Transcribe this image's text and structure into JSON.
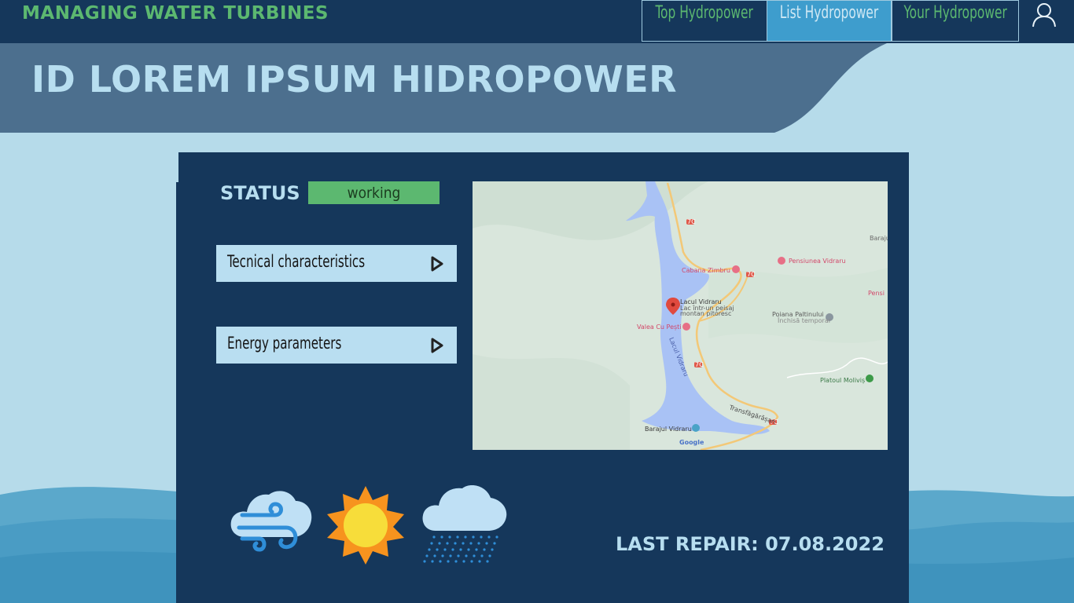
{
  "brand": "MANAGING WATER TURBINES",
  "nav": {
    "tabs": [
      {
        "label": "Top Hydropower",
        "active": false
      },
      {
        "label": "List Hydropower",
        "active": true
      },
      {
        "label": "Your Hydropower",
        "active": false
      }
    ],
    "user_icon": "user-icon"
  },
  "page": {
    "title": "ID LOREM IPSUM HIDROPOWER"
  },
  "status": {
    "label": "STATUS",
    "value": "working",
    "color": "#5cb870"
  },
  "sections": [
    {
      "label": "Tecnical characteristics",
      "icon": "play-arrow-icon"
    },
    {
      "label": "Energy parameters",
      "icon": "play-arrow-icon"
    }
  ],
  "map": {
    "labels": {
      "lake": "Lacul Vidraru",
      "lake_desc_1": "Lac într-un peisaj",
      "lake_desc_2": "montan pitoresc",
      "lake_vertical": "Lacul Vidraru",
      "cabana": "Cabana Zimbru",
      "pensiunea": "Pensiunea Vidraru",
      "poiana": "Poiana Paltinului",
      "poiana_status": "Închisă temporar",
      "valea": "Valea Cu Pești",
      "platoul": "Platoul Moliviș",
      "baraj_top": "Baraju",
      "pensi_right": "Pensi",
      "transfagarasan": "Transfăgărășan",
      "barajul": "Barajul Vidraru",
      "road": "7C",
      "google": "Google"
    }
  },
  "weather": [
    {
      "icon": "cloud-wind-icon"
    },
    {
      "icon": "sun-icon"
    },
    {
      "icon": "cloud-rain-icon"
    }
  ],
  "last_repair": "LAST REPAIR: 07.08.2022",
  "colors": {
    "page_bg": "#b6dbea",
    "dark_navy": "#15375b",
    "header_band": "#4c6f8e",
    "accent_green": "#5cb870",
    "active_tab": "#3e9dcd",
    "light_text": "#b7def0"
  }
}
